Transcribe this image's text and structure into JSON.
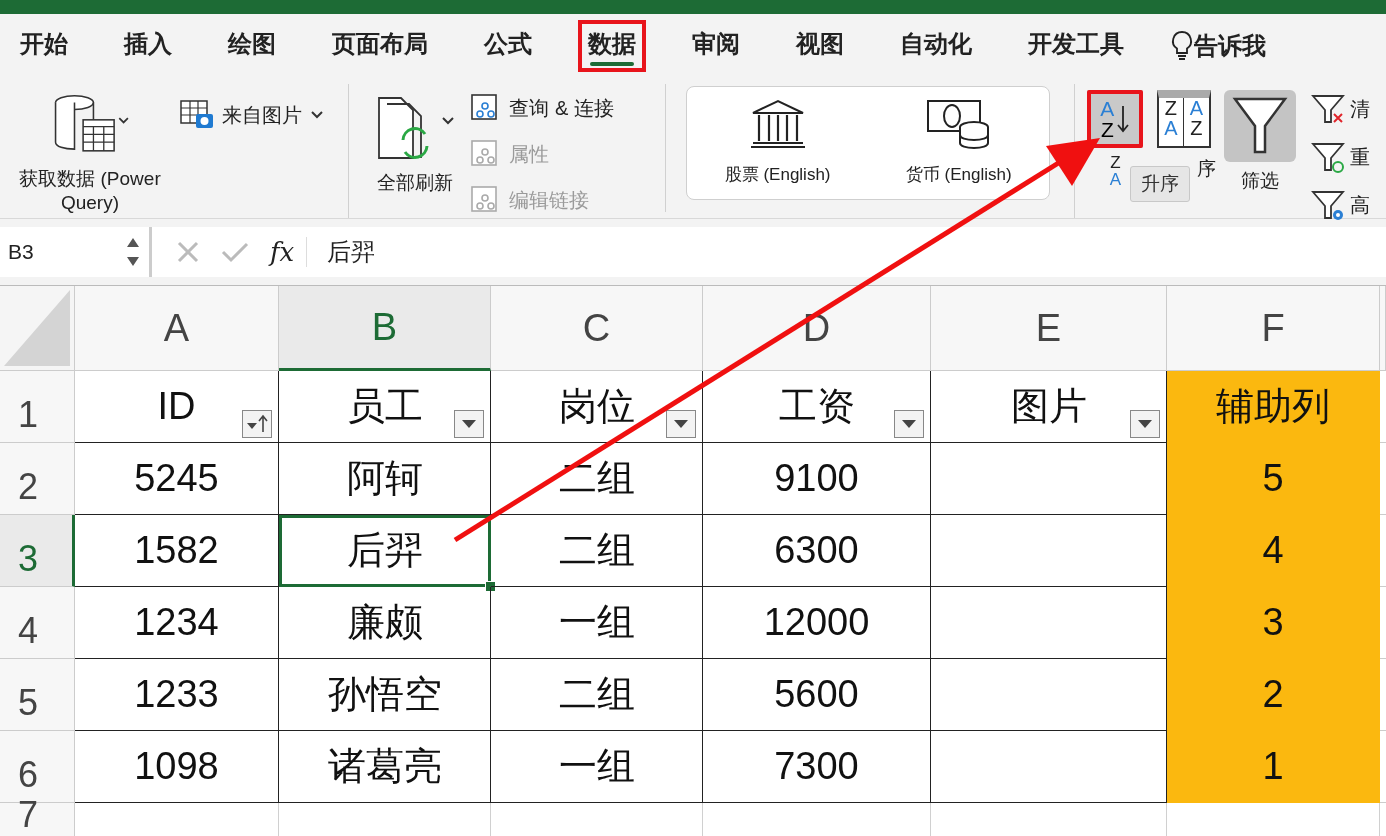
{
  "tabs": [
    {
      "label": "开始",
      "selected": false,
      "annotated": false
    },
    {
      "label": "插入",
      "selected": false,
      "annotated": false
    },
    {
      "label": "绘图",
      "selected": false,
      "annotated": false
    },
    {
      "label": "页面布局",
      "selected": false,
      "annotated": false
    },
    {
      "label": "公式",
      "selected": false,
      "annotated": false
    },
    {
      "label": "数据",
      "selected": true,
      "annotated": true
    },
    {
      "label": "审阅",
      "selected": false,
      "annotated": false
    },
    {
      "label": "视图",
      "selected": false,
      "annotated": false
    },
    {
      "label": "自动化",
      "selected": false,
      "annotated": false
    },
    {
      "label": "开发工具",
      "selected": false,
      "annotated": false
    }
  ],
  "tell_me": "告诉我",
  "ribbon": {
    "get_data": "获取数据 (Power Query)",
    "from_picture": "来自图片",
    "refresh_all": "全部刷新",
    "queries": [
      {
        "label": "查询 & 连接",
        "disabled": false
      },
      {
        "label": "属性",
        "disabled": true
      },
      {
        "label": "编辑链接",
        "disabled": true
      }
    ],
    "data_types": [
      {
        "label": "股票 (English)",
        "kind": "bank"
      },
      {
        "label": "货币 (English)",
        "kind": "currency"
      }
    ],
    "sort_ascending": {
      "letters": [
        "A",
        "Z"
      ],
      "selected": true,
      "annotated": true
    },
    "sort_descending": {
      "letters": [
        "Z",
        "A"
      ]
    },
    "sort": {
      "label": "序",
      "letters": [
        "Z",
        "A",
        "A",
        "Z"
      ]
    },
    "filter": {
      "label": "筛选",
      "selected": true
    },
    "filter_tools": [
      {
        "label": "清",
        "kind": "clear"
      },
      {
        "label": "重",
        "kind": "reapply"
      },
      {
        "label": "高",
        "kind": "advanced"
      }
    ],
    "tooltip": "升序"
  },
  "formula_bar": {
    "name_box": "B3",
    "fx": "fx",
    "value": "后羿"
  },
  "columns": [
    {
      "letter": "A",
      "selected": false,
      "fill": false
    },
    {
      "letter": "B",
      "selected": true,
      "fill": false
    },
    {
      "letter": "C",
      "selected": false,
      "fill": false
    },
    {
      "letter": "D",
      "selected": false,
      "fill": false
    },
    {
      "letter": "E",
      "selected": false,
      "fill": false
    },
    {
      "letter": "F",
      "selected": false,
      "fill": true
    }
  ],
  "rows": [
    {
      "number": "1",
      "selected": false,
      "cells": [
        {
          "text": "ID",
          "kind": "sorted-ascending"
        },
        {
          "text": "员工",
          "kind": "dropdown"
        },
        {
          "text": "岗位",
          "kind": "dropdown"
        },
        {
          "text": "工资",
          "kind": "dropdown"
        },
        {
          "text": "图片",
          "kind": "dropdown"
        },
        {
          "text": "辅助列"
        }
      ]
    },
    {
      "number": "2",
      "selected": false,
      "cells": [
        {
          "text": "5245"
        },
        {
          "text": "阿轲"
        },
        {
          "text": "二组"
        },
        {
          "text": "9100"
        },
        {},
        {
          "text": "5"
        }
      ]
    },
    {
      "number": "3",
      "selected": true,
      "cells": [
        {
          "text": "1582"
        },
        {
          "text": "后羿",
          "selected": true
        },
        {
          "text": "二组"
        },
        {
          "text": "6300"
        },
        {},
        {
          "text": "4"
        }
      ]
    },
    {
      "number": "4",
      "selected": false,
      "cells": [
        {
          "text": "1234"
        },
        {
          "text": "廉颇"
        },
        {
          "text": "一组"
        },
        {
          "text": "12000"
        },
        {},
        {
          "text": "3"
        }
      ]
    },
    {
      "number": "5",
      "selected": false,
      "cells": [
        {
          "text": "1233"
        },
        {
          "text": "孙悟空"
        },
        {
          "text": "二组"
        },
        {
          "text": "5600"
        },
        {},
        {
          "text": "2"
        }
      ]
    },
    {
      "number": "6",
      "selected": false,
      "cells": [
        {
          "text": "1098"
        },
        {
          "text": "诸葛亮"
        },
        {
          "text": "一组"
        },
        {
          "text": "7300"
        },
        {},
        {
          "text": "1"
        }
      ]
    },
    {
      "number": "7",
      "selected": false
    }
  ]
}
